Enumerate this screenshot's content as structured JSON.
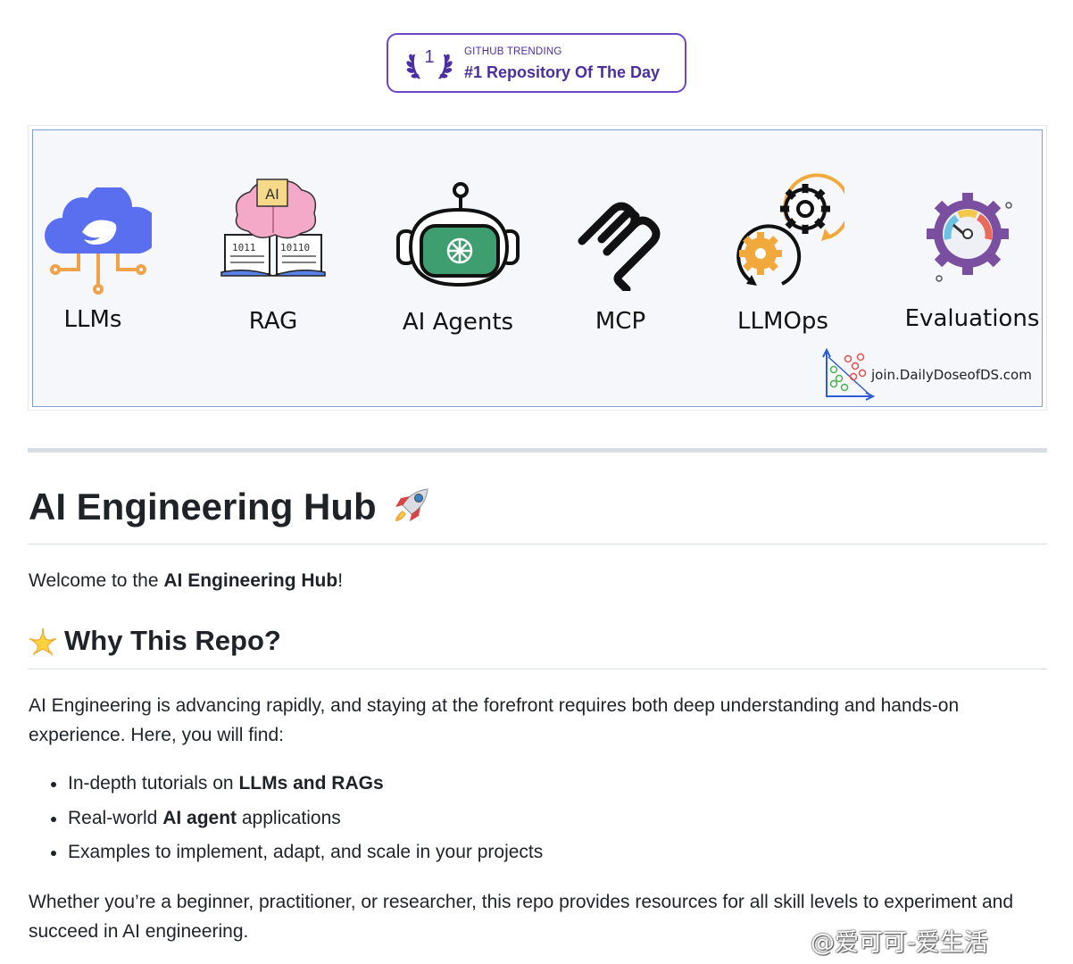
{
  "badge": {
    "rank": "1",
    "kicker": "GITHUB TRENDING",
    "title": "#1 Repository Of The Day"
  },
  "banner": {
    "topics": [
      {
        "label": "LLMs",
        "icon": "cloud-whale-icon"
      },
      {
        "label": "RAG",
        "icon": "brain-book-icon"
      },
      {
        "label": "AI Agents",
        "icon": "robot-head-icon"
      },
      {
        "label": "MCP",
        "icon": "mcp-logo-icon"
      },
      {
        "label": "LLMOps",
        "icon": "gears-cycle-icon"
      },
      {
        "label": "Evaluations",
        "icon": "gauge-gear-icon"
      }
    ],
    "chip_text": "AI",
    "book_text_left": "1011",
    "book_text_right": "10110",
    "footer": "join.DailyDoseofDS.com"
  },
  "article": {
    "title": "AI Engineering Hub",
    "title_emoji": "rocket-icon",
    "welcome_prefix": "Welcome to the ",
    "welcome_bold": "AI Engineering Hub",
    "welcome_suffix": "!",
    "section_title": "Why This Repo?",
    "section_emoji": "glowing-star-icon",
    "intro": "AI Engineering is advancing rapidly, and staying at the forefront requires both deep understanding and hands-on experience. Here, you will find:",
    "bullets": [
      {
        "pre": "In-depth tutorials on ",
        "bold": "LLMs and RAGs",
        "post": ""
      },
      {
        "pre": "Real-world ",
        "bold": "AI agent",
        "post": " applications"
      },
      {
        "pre": "Examples to implement, adapt, and scale in your projects",
        "bold": "",
        "post": ""
      }
    ],
    "closing": "Whether you’re a beginner, practitioner, or researcher, this repo provides resources for all skill levels to experiment and succeed in AI engineering."
  },
  "watermark": "@爱可可-爱生活",
  "colors": {
    "badge_purple": "#4b2fa0",
    "badge_border": "#6e45c7",
    "banner_bg": "#f6f7fa",
    "banner_border": "#7f9fd6",
    "cloud_blue": "#5a6ff0",
    "circuit_orange": "#f0a24a",
    "agent_green": "#3f9e6f",
    "gear_orange": "#f2a93b",
    "brain_pink": "#f4a9c8"
  }
}
